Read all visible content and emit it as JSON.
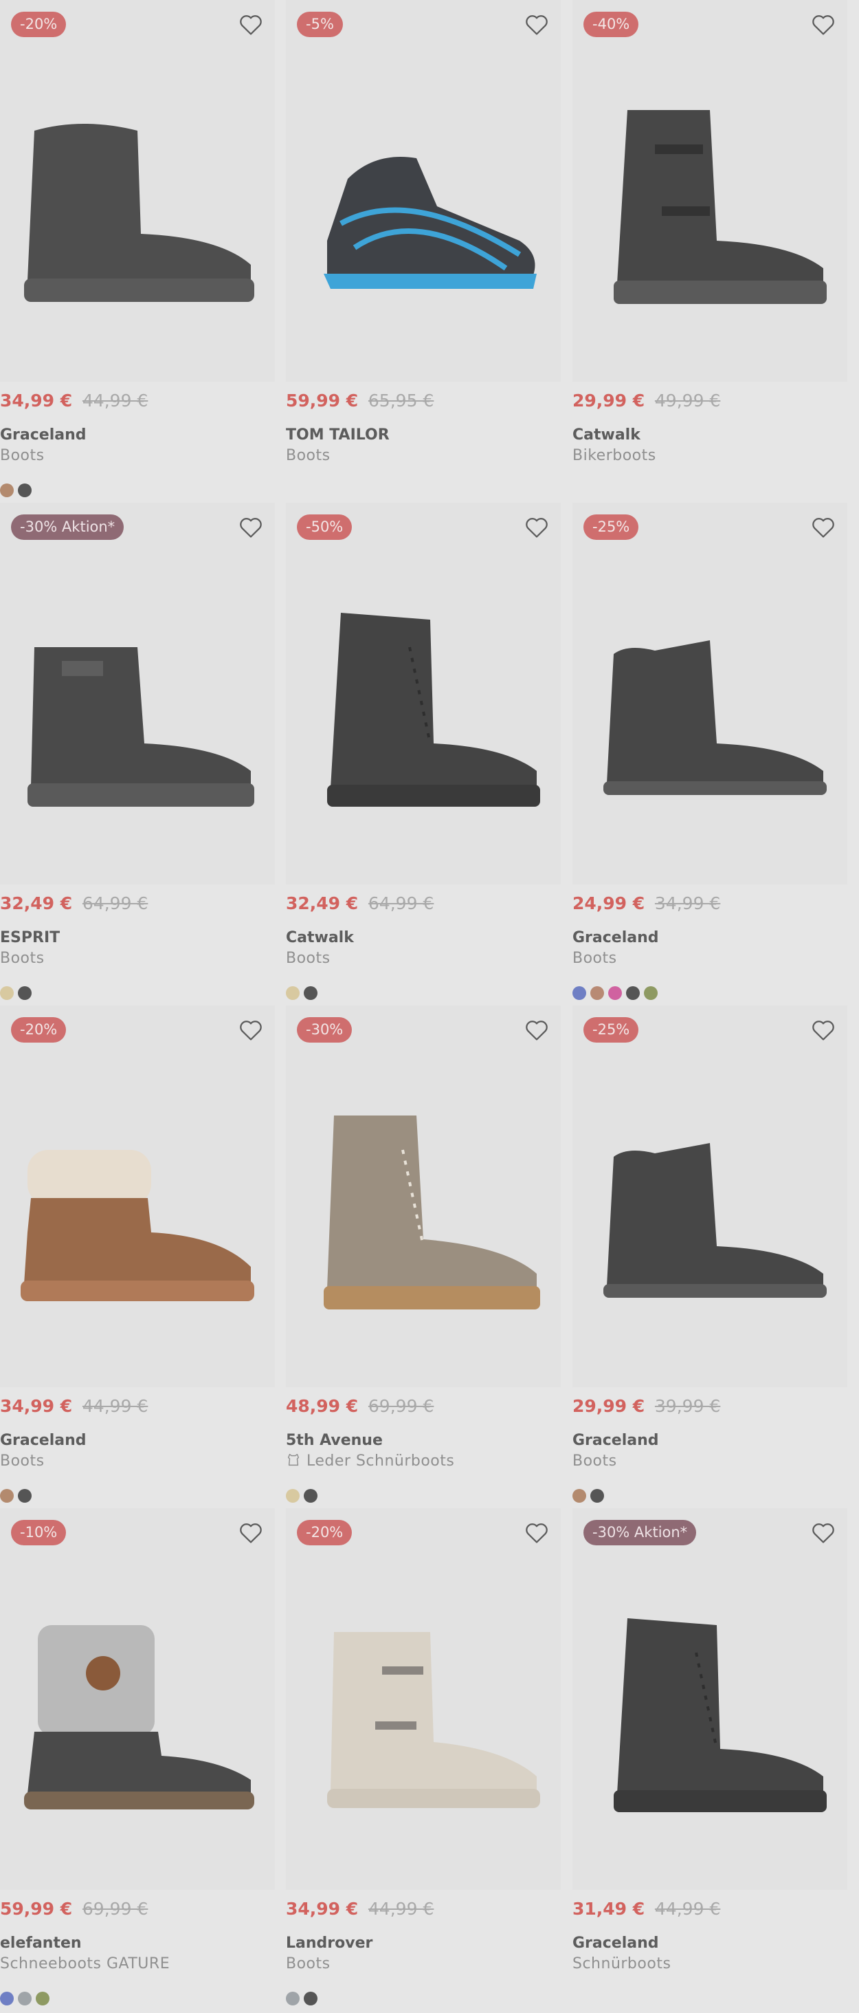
{
  "products": [
    {
      "badge": "-20%",
      "badge_type": "discount",
      "price": "34,99 €",
      "old_price": "44,99 €",
      "brand": "Graceland",
      "category": "Boots",
      "category_icon": "",
      "swatches": [
        "#b38a6e",
        "#555555"
      ],
      "shoe": "platform-fur-boot",
      "shoe_color": "#4e4e4e"
    },
    {
      "badge": "-5%",
      "badge_type": "discount",
      "price": "59,99 €",
      "old_price": "65,95 €",
      "brand": "TOM TAILOR",
      "category": "Boots",
      "category_icon": "",
      "swatches": [],
      "shoe": "sneaker-boot",
      "shoe_color": "#3f4247"
    },
    {
      "badge": "-40%",
      "badge_type": "discount",
      "price": "29,99 €",
      "old_price": "49,99 €",
      "brand": "Catwalk",
      "category": "Bikerboots",
      "category_icon": "",
      "swatches": [],
      "shoe": "biker-boot",
      "shoe_color": "#474747"
    },
    {
      "badge": "-30% Aktion*",
      "badge_type": "aktion",
      "price": "32,49 €",
      "old_price": "64,99 €",
      "brand": "ESPRIT",
      "category": "Boots",
      "category_icon": "",
      "swatches": [
        "#d8c9a0",
        "#555555"
      ],
      "shoe": "sock-boot",
      "shoe_color": "#4a4a4a"
    },
    {
      "badge": "-50%",
      "badge_type": "discount",
      "price": "32,49 €",
      "old_price": "64,99 €",
      "brand": "Catwalk",
      "category": "Boots",
      "category_icon": "",
      "swatches": [
        "#d8c9a0",
        "#555555"
      ],
      "shoe": "lace-boot",
      "shoe_color": "#444444"
    },
    {
      "badge": "-25%",
      "badge_type": "discount",
      "price": "24,99 €",
      "old_price": "34,99 €",
      "brand": "Graceland",
      "category": "Boots",
      "category_icon": "",
      "swatches": [
        "#6f7fc4",
        "#b88a74",
        "#d062a0",
        "#555555",
        "#8e9a62"
      ],
      "shoe": "ugg-boot",
      "shoe_color": "#474747"
    },
    {
      "badge": "-20%",
      "badge_type": "discount",
      "price": "34,99 €",
      "old_price": "44,99 €",
      "brand": "Graceland",
      "category": "Boots",
      "category_icon": "",
      "swatches": [
        "#b38a6e",
        "#555555"
      ],
      "shoe": "fur-cuff-boot",
      "shoe_color": "#9a6a4a"
    },
    {
      "badge": "-30%",
      "badge_type": "discount",
      "price": "48,99 €",
      "old_price": "69,99 €",
      "brand": "5th Avenue",
      "category": "Leder Schnürboots",
      "category_icon": "leather-icon",
      "swatches": [
        "#d8c9a0",
        "#555555"
      ],
      "shoe": "lace-boot-tan",
      "shoe_color": "#9b8f80"
    },
    {
      "badge": "-25%",
      "badge_type": "discount",
      "price": "29,99 €",
      "old_price": "39,99 €",
      "brand": "Graceland",
      "category": "Boots",
      "category_icon": "",
      "swatches": [
        "#b38a6e",
        "#555555"
      ],
      "shoe": "ugg-boot",
      "shoe_color": "#474747"
    },
    {
      "badge": "-10%",
      "badge_type": "discount",
      "price": "59,99 €",
      "old_price": "69,99 €",
      "brand": "elefanten",
      "category": "Schneeboots GATURE",
      "category_icon": "",
      "swatches": [
        "#6f7fc4",
        "#9fa4a8",
        "#8e9a62"
      ],
      "shoe": "snow-boot",
      "shoe_color": "#4a4a4a"
    },
    {
      "badge": "-20%",
      "badge_type": "discount",
      "price": "34,99 €",
      "old_price": "44,99 €",
      "brand": "Landrover",
      "category": "Boots",
      "category_icon": "",
      "swatches": [
        "#9fa4a8",
        "#555555"
      ],
      "shoe": "buckle-boot",
      "shoe_color": "#d9d2c6"
    },
    {
      "badge": "-30% Aktion*",
      "badge_type": "aktion",
      "price": "31,49 €",
      "old_price": "44,99 €",
      "brand": "Graceland",
      "category": "Schnürboots",
      "category_icon": "",
      "swatches": [],
      "shoe": "lace-boot",
      "shoe_color": "#444444"
    }
  ]
}
